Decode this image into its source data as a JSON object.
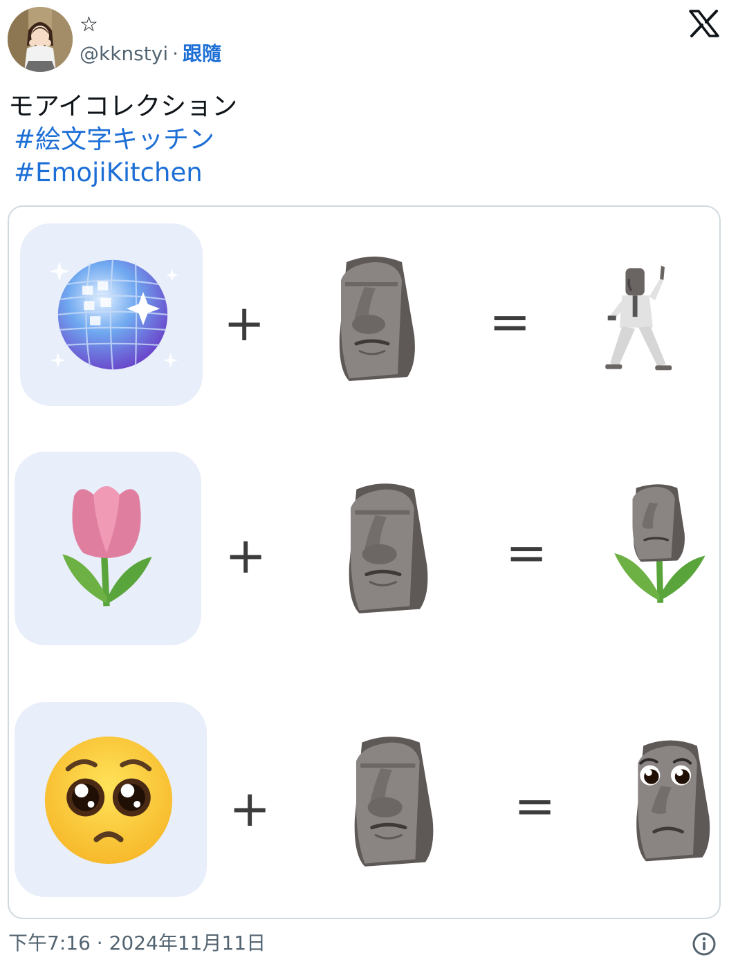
{
  "author": {
    "display_name": "☆",
    "handle": "@kknstyi",
    "separator": "·",
    "follow_label": "跟隨"
  },
  "tweet": {
    "text": "モアイコレクション",
    "hashtags": [
      "#絵文字キッチン",
      "#EmojiKitchen"
    ]
  },
  "media": {
    "rows": [
      {
        "left_emoji": "disco-ball",
        "operator_plus": "+",
        "middle_emoji": "moai",
        "operator_equals": "=",
        "result_emoji": "dancing-moai"
      },
      {
        "left_emoji": "tulip",
        "operator_plus": "+",
        "middle_emoji": "moai",
        "operator_equals": "=",
        "result_emoji": "tulip-moai"
      },
      {
        "left_emoji": "pleading-face",
        "operator_plus": "+",
        "middle_emoji": "moai",
        "operator_equals": "=",
        "result_emoji": "pleading-moai"
      }
    ]
  },
  "footer": {
    "timestamp": "下午7:16 · 2024年11月11日"
  },
  "icons": {
    "logo": "x-logo",
    "info": "info-icon"
  },
  "colors": {
    "link": "#1d6fd6",
    "muted": "#536471",
    "border": "#cfd9de",
    "tile": "#e8eefa"
  }
}
